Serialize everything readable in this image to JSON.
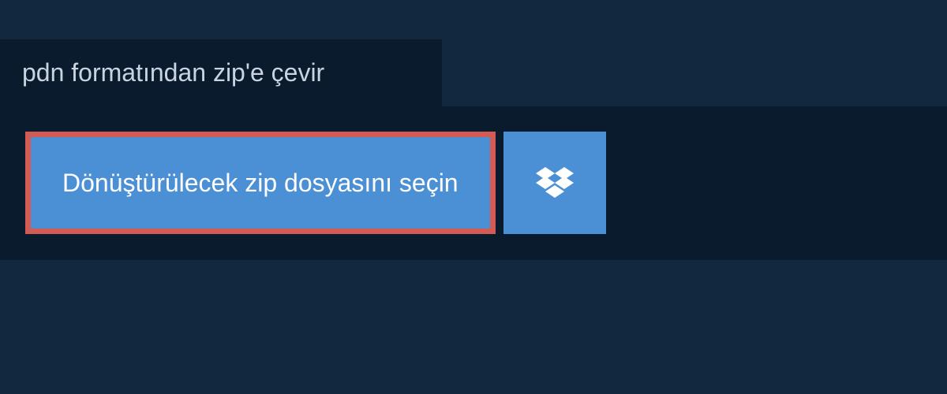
{
  "header": {
    "title": "pdn formatından zip'e çevir"
  },
  "main": {
    "file_select_label": "Dönüştürülecek zip dosyasını seçin"
  },
  "colors": {
    "background": "#11283f",
    "panel": "#0a1b2e",
    "button_primary": "#4b8fd5",
    "button_border_highlight": "#d45a56",
    "text_light": "#c8d4e0",
    "text_white": "#ffffff"
  }
}
